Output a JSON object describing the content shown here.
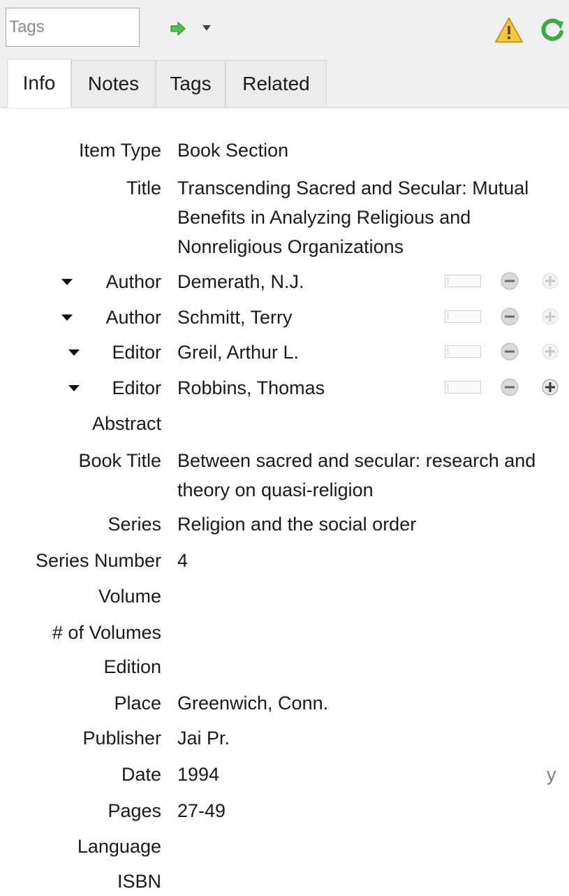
{
  "toolbar": {
    "tags_placeholder": "Tags",
    "go_icon": "green-right-arrow-icon",
    "warning_icon": "warning-triangle-icon",
    "sync_icon": "green-sync-icon"
  },
  "tabs": [
    "Info",
    "Notes",
    "Tags",
    "Related"
  ],
  "active_tab": "Info",
  "info": {
    "item_type": {
      "label": "Item Type",
      "value": "Book Section"
    },
    "title": {
      "label": "Title",
      "lines": [
        "Transcending Sacred and Secular: Mutual",
        "Benefits in Analyzing Religious and",
        "Nonreligious Organizations"
      ]
    },
    "creators": [
      {
        "role": "Author",
        "name": "Demerath, N.J."
      },
      {
        "role": "Author",
        "name": "Schmitt, Terry"
      },
      {
        "role": "Editor",
        "name": "Greil, Arthur L."
      },
      {
        "role": "Editor",
        "name": "Robbins, Thomas"
      }
    ],
    "abstract": {
      "label": "Abstract",
      "value": ""
    },
    "book_title": {
      "label": "Book Title",
      "lines": [
        "Between sacred and secular: research and",
        "theory on quasi-religion"
      ]
    },
    "series": {
      "label": "Series",
      "value": "Religion and the social order"
    },
    "series_number": {
      "label": "Series Number",
      "value": "4"
    },
    "volume": {
      "label": "Volume",
      "value": ""
    },
    "num_volumes": {
      "label": "# of Volumes",
      "value": ""
    },
    "edition": {
      "label": "Edition",
      "value": ""
    },
    "place": {
      "label": "Place",
      "value": "Greenwich, Conn."
    },
    "publisher": {
      "label": "Publisher",
      "value": "Jai Pr."
    },
    "date": {
      "label": "Date",
      "value": "1994",
      "parsed": "y"
    },
    "pages": {
      "label": "Pages",
      "value": "27-49"
    },
    "language": {
      "label": "Language",
      "value": ""
    },
    "isbn": {
      "label": "ISBN",
      "value": ""
    }
  },
  "colors": {
    "toolbar_bg": "#f0f0f0",
    "accent_green": "#3cb043",
    "warning_yellow": "#f5c518"
  }
}
